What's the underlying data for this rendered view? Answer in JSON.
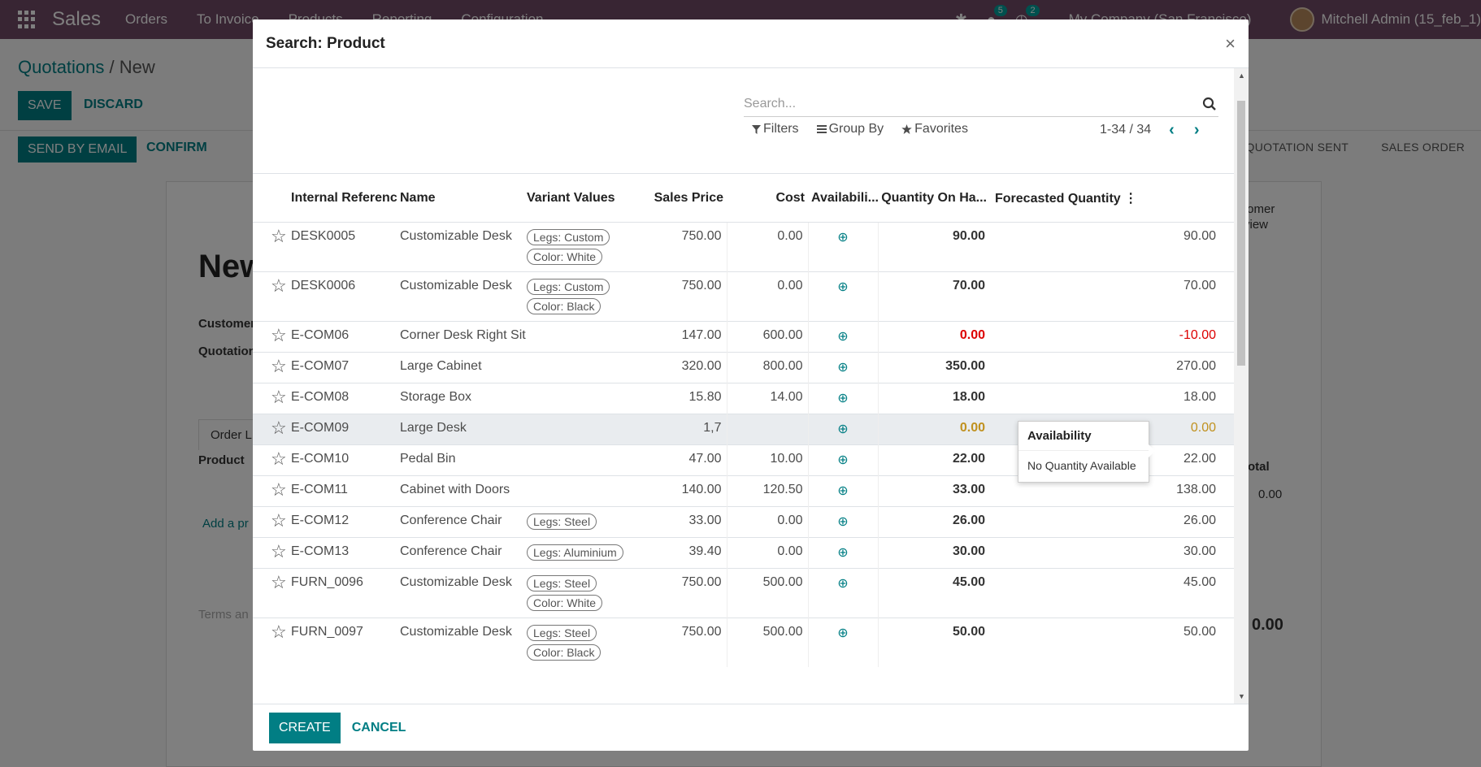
{
  "navbar": {
    "app_name": "Sales",
    "menus": [
      "Orders",
      "To Invoice",
      "Products",
      "Reporting",
      "Configuration"
    ],
    "messages_badge": "5",
    "activities_badge": "2",
    "company": "My Company (San Francisco)",
    "user": "Mitchell Admin (15_feb_1)"
  },
  "background": {
    "breadcrumb_parent": "Quotations",
    "breadcrumb_current": "New",
    "save_label": "SAVE",
    "discard_label": "DISCARD",
    "send_email_label": "SEND BY EMAIL",
    "confirm_label": "CONFIRM",
    "status_sent": "QUOTATION SENT",
    "status_order": "SALES ORDER",
    "title": "New",
    "customer_label": "Customer",
    "quotation_label": "Quotation",
    "tab_order_lines": "Order L",
    "product_col": "Product",
    "add_line": "Add a pr",
    "terms": "Terms an",
    "total_label": "otal",
    "row_total": "0.00",
    "grand_total": "0.00",
    "customer_preview_1": "tomer",
    "customer_preview_2": "view"
  },
  "modal": {
    "title": "Search: Product",
    "search_placeholder": "Search...",
    "filters_label": "Filters",
    "group_by_label": "Group By",
    "favorites_label": "Favorites",
    "pager_value": "1-34 / 34",
    "columns": {
      "internal_ref": "Internal Reference",
      "name": "Name",
      "variant_values": "Variant Values",
      "sales_price": "Sales Price",
      "cost": "Cost",
      "availability": "Availabili...",
      "qty_on_hand": "Quantity On Ha...",
      "forecasted": "Forecasted Quantity"
    },
    "rows": [
      {
        "ref": "DESK0005",
        "name": "Customizable Desk",
        "tag1": "Legs: Custom",
        "tag2": "Color: White",
        "price": "750.00",
        "cost": "0.00",
        "qty": "90.00",
        "forecast": "90.00"
      },
      {
        "ref": "DESK0006",
        "name": "Customizable Desk",
        "tag1": "Legs: Custom",
        "tag2": "Color: Black",
        "price": "750.00",
        "cost": "0.00",
        "qty": "70.00",
        "forecast": "70.00"
      },
      {
        "ref": "E-COM06",
        "name": "Corner Desk Right Sit",
        "tag1": "",
        "tag2": "",
        "price": "147.00",
        "cost": "600.00",
        "qty": "0.00",
        "forecast": "-10.00"
      },
      {
        "ref": "E-COM07",
        "name": "Large Cabinet",
        "tag1": "",
        "tag2": "",
        "price": "320.00",
        "cost": "800.00",
        "qty": "350.00",
        "forecast": "270.00"
      },
      {
        "ref": "E-COM08",
        "name": "Storage Box",
        "tag1": "",
        "tag2": "",
        "price": "15.80",
        "cost": "14.00",
        "qty": "18.00",
        "forecast": "18.00"
      },
      {
        "ref": "E-COM09",
        "name": "Large Desk",
        "tag1": "",
        "tag2": "",
        "price": "1,7",
        "cost": "",
        "qty": "0.00",
        "forecast": "0.00"
      },
      {
        "ref": "E-COM10",
        "name": "Pedal Bin",
        "tag1": "",
        "tag2": "",
        "price": "47.00",
        "cost": "10.00",
        "qty": "22.00",
        "forecast": "22.00"
      },
      {
        "ref": "E-COM11",
        "name": "Cabinet with Doors",
        "tag1": "",
        "tag2": "",
        "price": "140.00",
        "cost": "120.50",
        "qty": "33.00",
        "forecast": "138.00"
      },
      {
        "ref": "E-COM12",
        "name": "Conference Chair",
        "tag1": "Legs: Steel",
        "tag2": "",
        "price": "33.00",
        "cost": "0.00",
        "qty": "26.00",
        "forecast": "26.00"
      },
      {
        "ref": "E-COM13",
        "name": "Conference Chair",
        "tag1": "Legs: Aluminium",
        "tag2": "",
        "price": "39.40",
        "cost": "0.00",
        "qty": "30.00",
        "forecast": "30.00"
      },
      {
        "ref": "FURN_0096",
        "name": "Customizable Desk",
        "tag1": "Legs: Steel",
        "tag2": "Color: White",
        "price": "750.00",
        "cost": "500.00",
        "qty": "45.00",
        "forecast": "45.00"
      },
      {
        "ref": "FURN_0097",
        "name": "Customizable Desk",
        "tag1": "Legs: Steel",
        "tag2": "Color: Black",
        "price": "750.00",
        "cost": "500.00",
        "qty": "50.00",
        "forecast": "50.00"
      }
    ],
    "popover": {
      "title": "Availability",
      "body": "No Quantity Available"
    },
    "create_label": "CREATE",
    "cancel_label": "CANCEL"
  },
  "colors": {
    "brand": "#714B67",
    "accent": "#017e84",
    "danger": "#dd0000",
    "warning": "#c0911f"
  }
}
